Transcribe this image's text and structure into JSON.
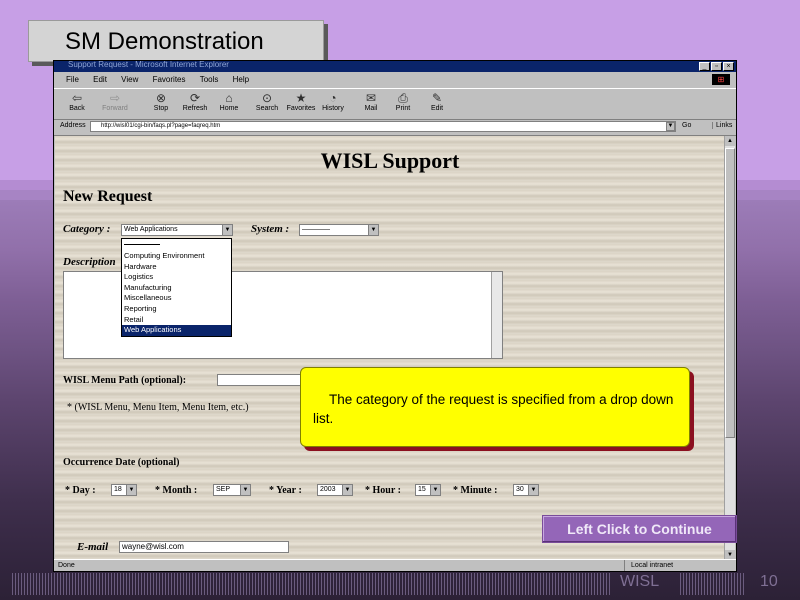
{
  "slide": {
    "title": "SM Demonstration",
    "callout_text": "The category of the request is specified from a drop down list.",
    "continue_label": "Left Click to Continue",
    "footer_brand": "WISL",
    "page_number": "10"
  },
  "browser": {
    "window_title": "Support Request - Microsoft Internet Explorer",
    "menu": [
      "File",
      "Edit",
      "View",
      "Favorites",
      "Tools",
      "Help"
    ],
    "toolbar": [
      {
        "label": "Back",
        "icon": "back-arrow-icon",
        "disabled": false
      },
      {
        "label": "Forward",
        "icon": "forward-arrow-icon",
        "disabled": true
      },
      {
        "label": "Stop",
        "icon": "stop-icon",
        "disabled": false
      },
      {
        "label": "Refresh",
        "icon": "refresh-icon",
        "disabled": false
      },
      {
        "label": "Home",
        "icon": "home-icon",
        "disabled": false
      },
      {
        "label": "Search",
        "icon": "search-icon",
        "disabled": false
      },
      {
        "label": "Favorites",
        "icon": "favorites-icon",
        "disabled": false
      },
      {
        "label": "History",
        "icon": "history-icon",
        "disabled": false
      },
      {
        "label": "Mail",
        "icon": "mail-icon",
        "disabled": false
      },
      {
        "label": "Print",
        "icon": "print-icon",
        "disabled": false
      },
      {
        "label": "Edit",
        "icon": "edit-icon",
        "disabled": false
      }
    ],
    "address_label": "Address",
    "address_url": "http://wisl01/cgi-bin/faqs.pl?page=faqreq.htm",
    "go_label": "Go",
    "links_label": "Links",
    "status_left": "Done",
    "status_right": "Local intranet"
  },
  "form": {
    "page_heading": "WISL Support",
    "section_heading": "New Request",
    "category_label": "Category :",
    "category_value": "Web Applications",
    "system_label": "System :",
    "system_value": "————",
    "description_label": "Description",
    "category_options": [
      "Computing Environment",
      "Hardware",
      "Logistics",
      "Manufacturing",
      "Miscellaneous",
      "Reporting",
      "Retail",
      "Web Applications"
    ],
    "selected_option": "Web Applications",
    "menu_path_label": "WISL Menu Path (optional):",
    "menu_path_hint": "*  (WISL Menu, Menu Item, Menu Item, etc.)",
    "occurrence_label": "Occurrence Date (optional)",
    "day_label": "* Day :",
    "day_value": "18",
    "month_label": "* Month :",
    "month_value": "SEP",
    "year_label": "* Year :",
    "year_value": "2003",
    "hour_label": "* Hour :",
    "hour_value": "15",
    "minute_label": "* Minute :",
    "minute_value": "30",
    "email_label": "E-mail",
    "email_value": "wayne@wisl.com"
  }
}
